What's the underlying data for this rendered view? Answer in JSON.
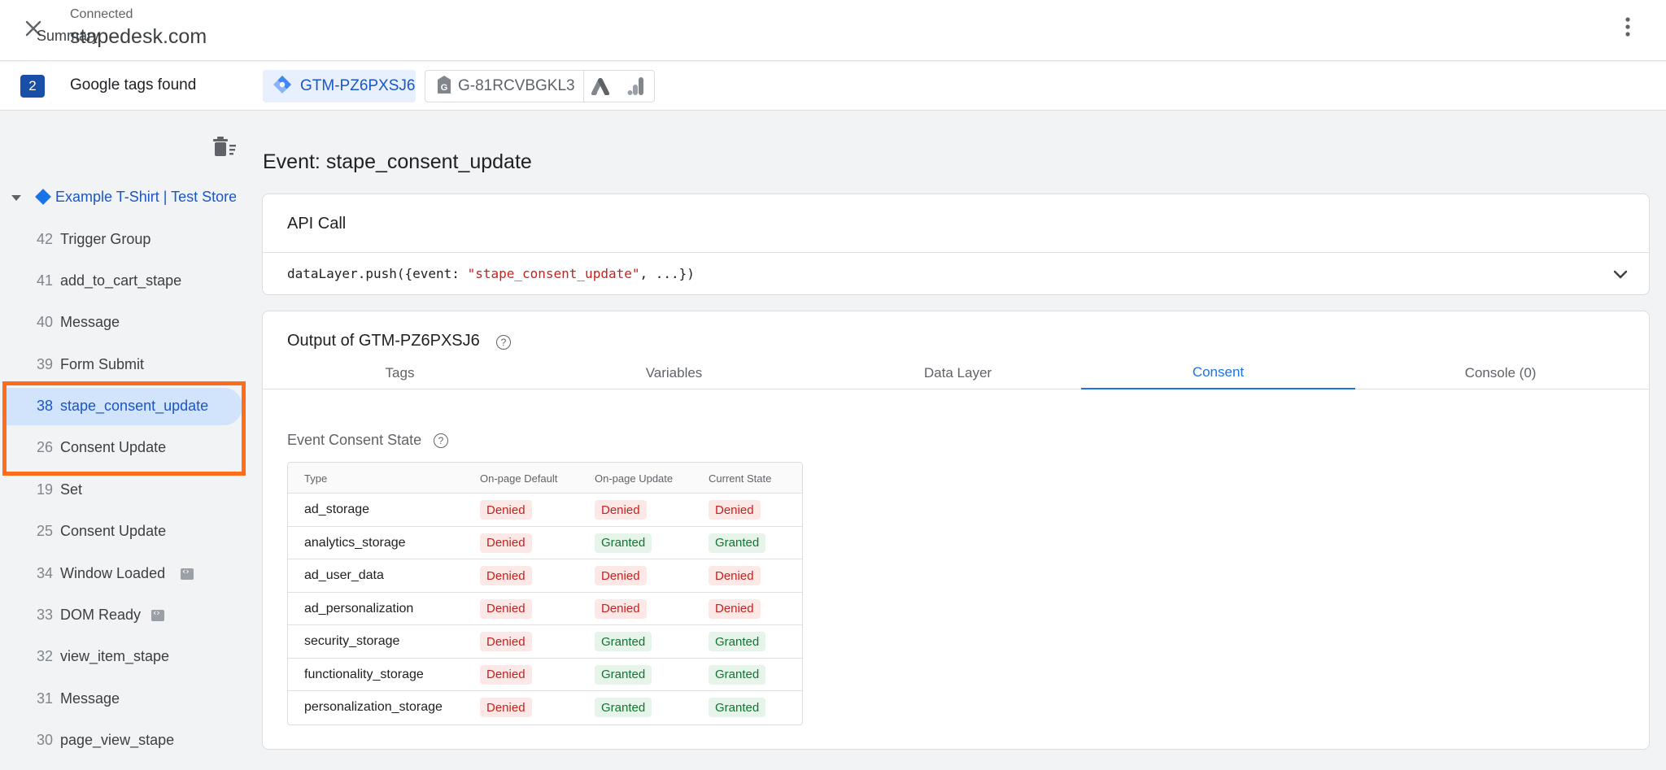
{
  "header": {
    "status": "Connected",
    "site": "stapedesk.com"
  },
  "tagbar": {
    "count": "2",
    "label": "Google tags found",
    "gtm_id": "GTM-PZ6PXSJ6",
    "ga_id": "G-81RCVBGKL3"
  },
  "sidebar": {
    "summary": "Summary",
    "page": "Example T-Shirt | Test Store",
    "events": [
      {
        "num": "42",
        "name": "Trigger Group"
      },
      {
        "num": "41",
        "name": "add_to_cart_stape"
      },
      {
        "num": "40",
        "name": "Message"
      },
      {
        "num": "39",
        "name": "Form Submit"
      },
      {
        "num": "38",
        "name": "stape_consent_update"
      },
      {
        "num": "26",
        "name": "Consent Update"
      },
      {
        "num": "19",
        "name": "Set"
      },
      {
        "num": "25",
        "name": "Consent Update"
      },
      {
        "num": "34",
        "name": "Window Loaded"
      },
      {
        "num": "33",
        "name": "DOM Ready"
      },
      {
        "num": "32",
        "name": "view_item_stape"
      },
      {
        "num": "31",
        "name": "Message"
      },
      {
        "num": "30",
        "name": "page_view_stape"
      }
    ]
  },
  "main": {
    "event_title": "Event: stape_consent_update",
    "api": {
      "title": "API Call",
      "code_prefix": "dataLayer.push({event: ",
      "code_string": "\"stape_consent_update\"",
      "code_suffix": ", ...})"
    },
    "output": {
      "title": "Output of GTM-PZ6PXSJ6",
      "tabs": [
        "Tags",
        "Variables",
        "Data Layer",
        "Consent",
        "Console (0)"
      ],
      "active_tab": "Consent",
      "section_title": "Event Consent State",
      "table": {
        "headers": [
          "Type",
          "On-page Default",
          "On-page Update",
          "Current State"
        ],
        "rows": [
          [
            "ad_storage",
            "Denied",
            "Denied",
            "Denied"
          ],
          [
            "analytics_storage",
            "Denied",
            "Granted",
            "Granted"
          ],
          [
            "ad_user_data",
            "Denied",
            "Denied",
            "Denied"
          ],
          [
            "ad_personalization",
            "Denied",
            "Denied",
            "Denied"
          ],
          [
            "security_storage",
            "Denied",
            "Granted",
            "Granted"
          ],
          [
            "functionality_storage",
            "Denied",
            "Granted",
            "Granted"
          ],
          [
            "personalization_storage",
            "Denied",
            "Granted",
            "Granted"
          ]
        ]
      }
    }
  },
  "colors": {
    "accent": "#1a73e8",
    "highlight": "#ff6d1b",
    "denied_bg": "#fce8e6",
    "granted_bg": "#e6f4ea"
  }
}
